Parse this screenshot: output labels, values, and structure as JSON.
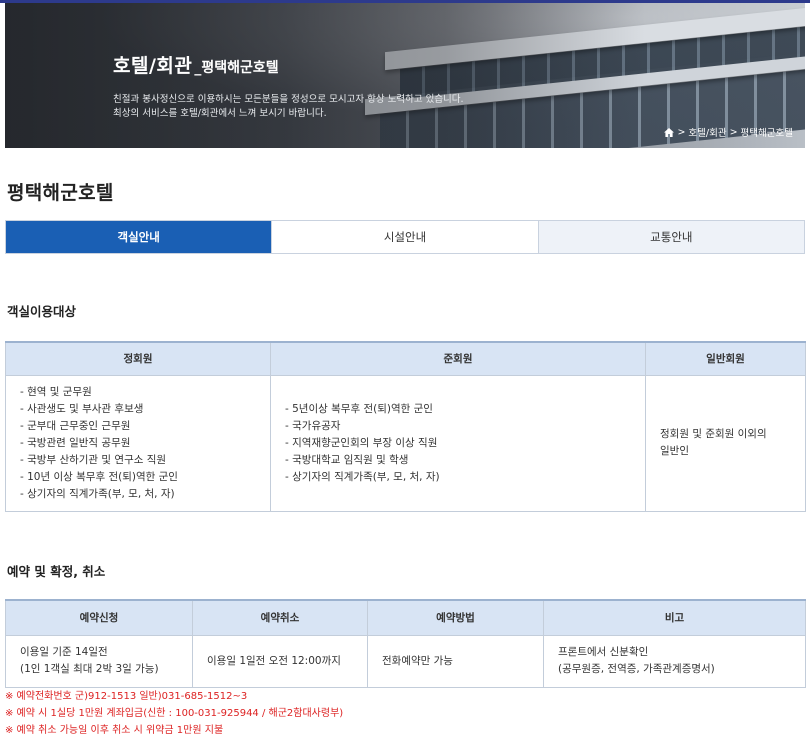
{
  "hero": {
    "title": "호텔/회관",
    "subtitle": "_평택해군호텔",
    "desc_line1": "친절과 봉사정신으로 이용하시는 모든분들을 정성으로 모시고자 항상 노력하고 있습니다.",
    "desc_line2": "최상의 서비스를 호텔/회관에서 느껴 보시기 바랍니다.",
    "breadcrumb": [
      "호텔/회관",
      "평택해군호텔"
    ],
    "breadcrumb_sep": ">"
  },
  "page_title": "평택해군호텔",
  "tabs": [
    {
      "label": "객실안내"
    },
    {
      "label": "시설안내"
    },
    {
      "label": "교통안내"
    }
  ],
  "section1": {
    "title": "객실이용대상",
    "headers": [
      "정회원",
      "준회원",
      "일반회원"
    ],
    "regular": [
      "- 현역 및 군무원",
      "- 사관생도 및 부사관 후보생",
      "- 군부대 근무중인 근무원",
      "- 국방관련 일반직 공무원",
      "- 국방부 산하기관 및 연구소 직원",
      "- 10년 이상 복무후 전(퇴)역한 군인",
      "- 상기자의 직계가족(부, 모, 처, 자)"
    ],
    "associate": [
      "- 5년이상 복무후 전(퇴)역한 군인",
      "- 국가유공자",
      "- 지역재향군인회의 부장 이상 직원",
      "- 국방대학교 임직원 및 학생",
      "- 상기자의 직계가족(부, 모, 처, 자)"
    ],
    "general_line1": "정회원 및 준회원 이외의",
    "general_line2": "일반인"
  },
  "section2": {
    "title": "예약 및 확정, 취소",
    "headers": [
      "예약신청",
      "예약취소",
      "예약방법",
      "비고"
    ],
    "apply_line1": "이용일 기준 14일전",
    "apply_line2": "(1인 1객실 최대 2박 3일 가능)",
    "cancel": "이용일 1일전 오전 12:00까지",
    "method": "전화예약만 가능",
    "note_line1": "프론트에서 신분확인",
    "note_line2": "(공무원증, 전역증, 가족관계증명서)"
  },
  "notes": [
    "※ 예약전화번호 군)912-1513 일반)031-685-1512~3",
    "※ 예약 시 1실당 1만원 계좌입금(신한 : 100-031-925944 / 해군2함대사령부)",
    "※ 예약 취소 가능일 이후 취소 시 위약금 1만원 지불"
  ],
  "colors": {
    "accent": "#1a5fb4",
    "header_bg": "#d8e4f4",
    "note_red": "#dd2222"
  },
  "icons": {
    "home": "home-icon"
  }
}
